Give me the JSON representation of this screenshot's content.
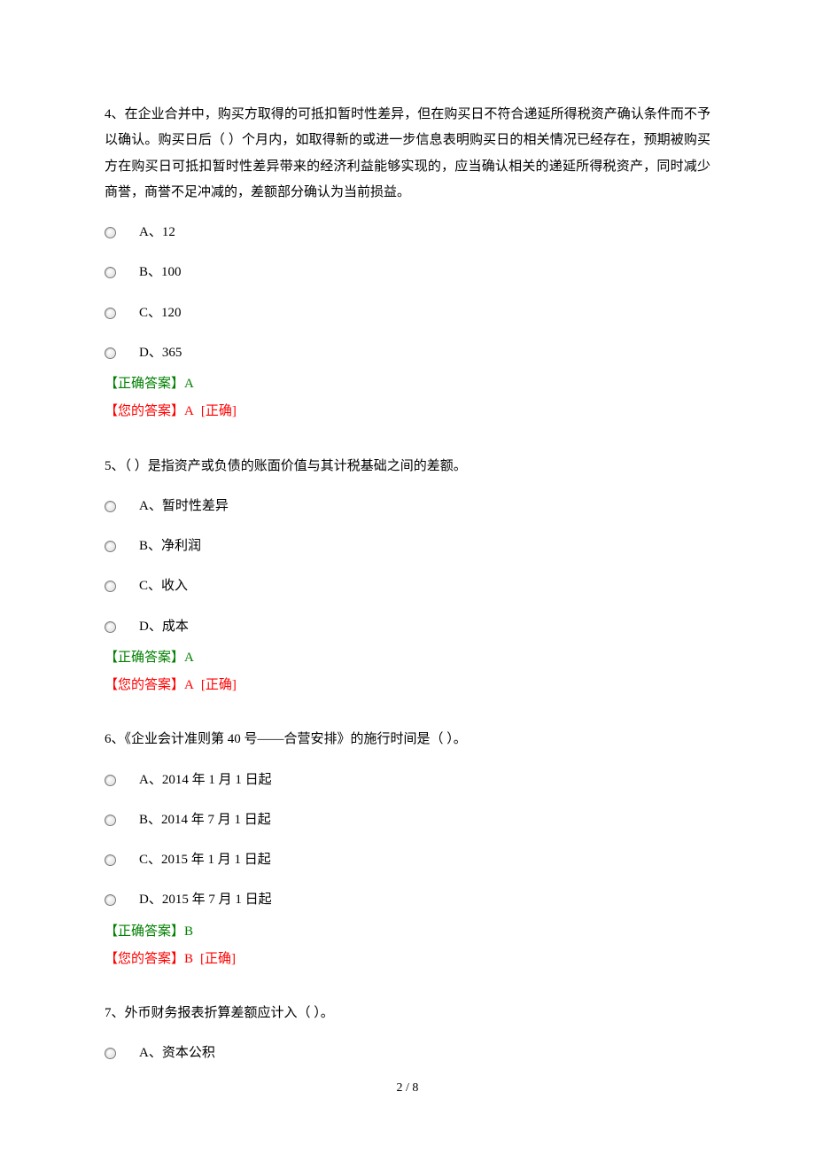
{
  "questions": [
    {
      "stem": "4、在企业合并中，购买方取得的可抵扣暂时性差异，但在购买日不符合递延所得税资产确认条件而不予以确认。购买日后（   ）个月内，如取得新的或进一步信息表明购买日的相关情况已经存在，预期被购买方在购买日可抵扣暂时性差异带来的经济利益能够实现的，应当确认相关的递延所得税资产，同时减少商誉，商誉不足冲减的，差额部分确认为当前损益。",
      "options": {
        "a": "A、12",
        "b": "B、100",
        "c": "C、120",
        "d": "D、365"
      },
      "correct_label": "【正确答案】",
      "correct_value": "A",
      "your_label": "【您的答案】",
      "your_value": "A",
      "status": "[正确]"
    },
    {
      "stem": "5、（   ）是指资产或负债的账面价值与其计税基础之间的差额。",
      "options": {
        "a": "A、暂时性差异",
        "b": "B、净利润",
        "c": "C、收入",
        "d": "D、成本"
      },
      "correct_label": "【正确答案】",
      "correct_value": "A",
      "your_label": "【您的答案】",
      "your_value": "A",
      "status": "[正确]"
    },
    {
      "stem": "6、《企业会计准则第 40 号——合营安排》的施行时间是（     ）。",
      "options": {
        "a": "A、2014 年 1 月 1 日起",
        "b": "B、2014 年 7 月 1 日起",
        "c": "C、2015 年 1 月 1 日起",
        "d": "D、2015 年 7 月 1 日起"
      },
      "correct_label": "【正确答案】",
      "correct_value": "B",
      "your_label": "【您的答案】",
      "your_value": "B",
      "status": "[正确]"
    },
    {
      "stem": "7、外币财务报表折算差额应计入（     ）。",
      "options": {
        "a": "A、资本公积"
      }
    }
  ],
  "footer": {
    "page": "2  /  8"
  }
}
